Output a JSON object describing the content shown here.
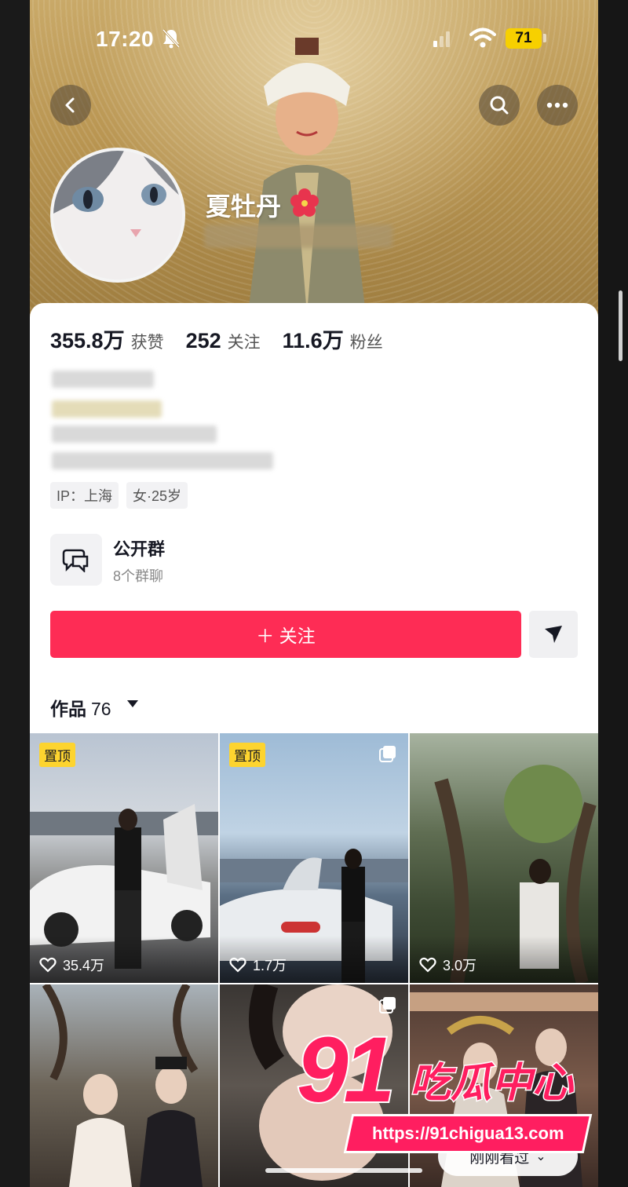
{
  "status_bar": {
    "time": "17:20",
    "battery": "71"
  },
  "profile": {
    "name": "夏牡丹",
    "stats": [
      {
        "value": "355.8万",
        "label": "获赞"
      },
      {
        "value": "252",
        "label": "关注"
      },
      {
        "value": "11.6万",
        "label": "粉丝"
      }
    ],
    "tags": [
      "IP：上海",
      "女·25岁"
    ]
  },
  "group": {
    "title": "公开群",
    "subtitle": "8个群聊"
  },
  "actions": {
    "follow_label": "＋ 关注"
  },
  "works": {
    "label": "作品",
    "count": "76"
  },
  "videos": [
    {
      "pin": "置顶",
      "likes": "35.4万"
    },
    {
      "pin": "置顶",
      "likes": "1.7万"
    },
    {
      "likes": "3.0万"
    }
  ],
  "recently_viewed": "刚刚看过",
  "watermark": {
    "number": "91",
    "brand": "吃瓜中心",
    "url": "https://91chigua13.com"
  },
  "colors": {
    "accent": "#fe2c55",
    "pin": "#fdd42f",
    "watermark": "#ff1e60"
  }
}
